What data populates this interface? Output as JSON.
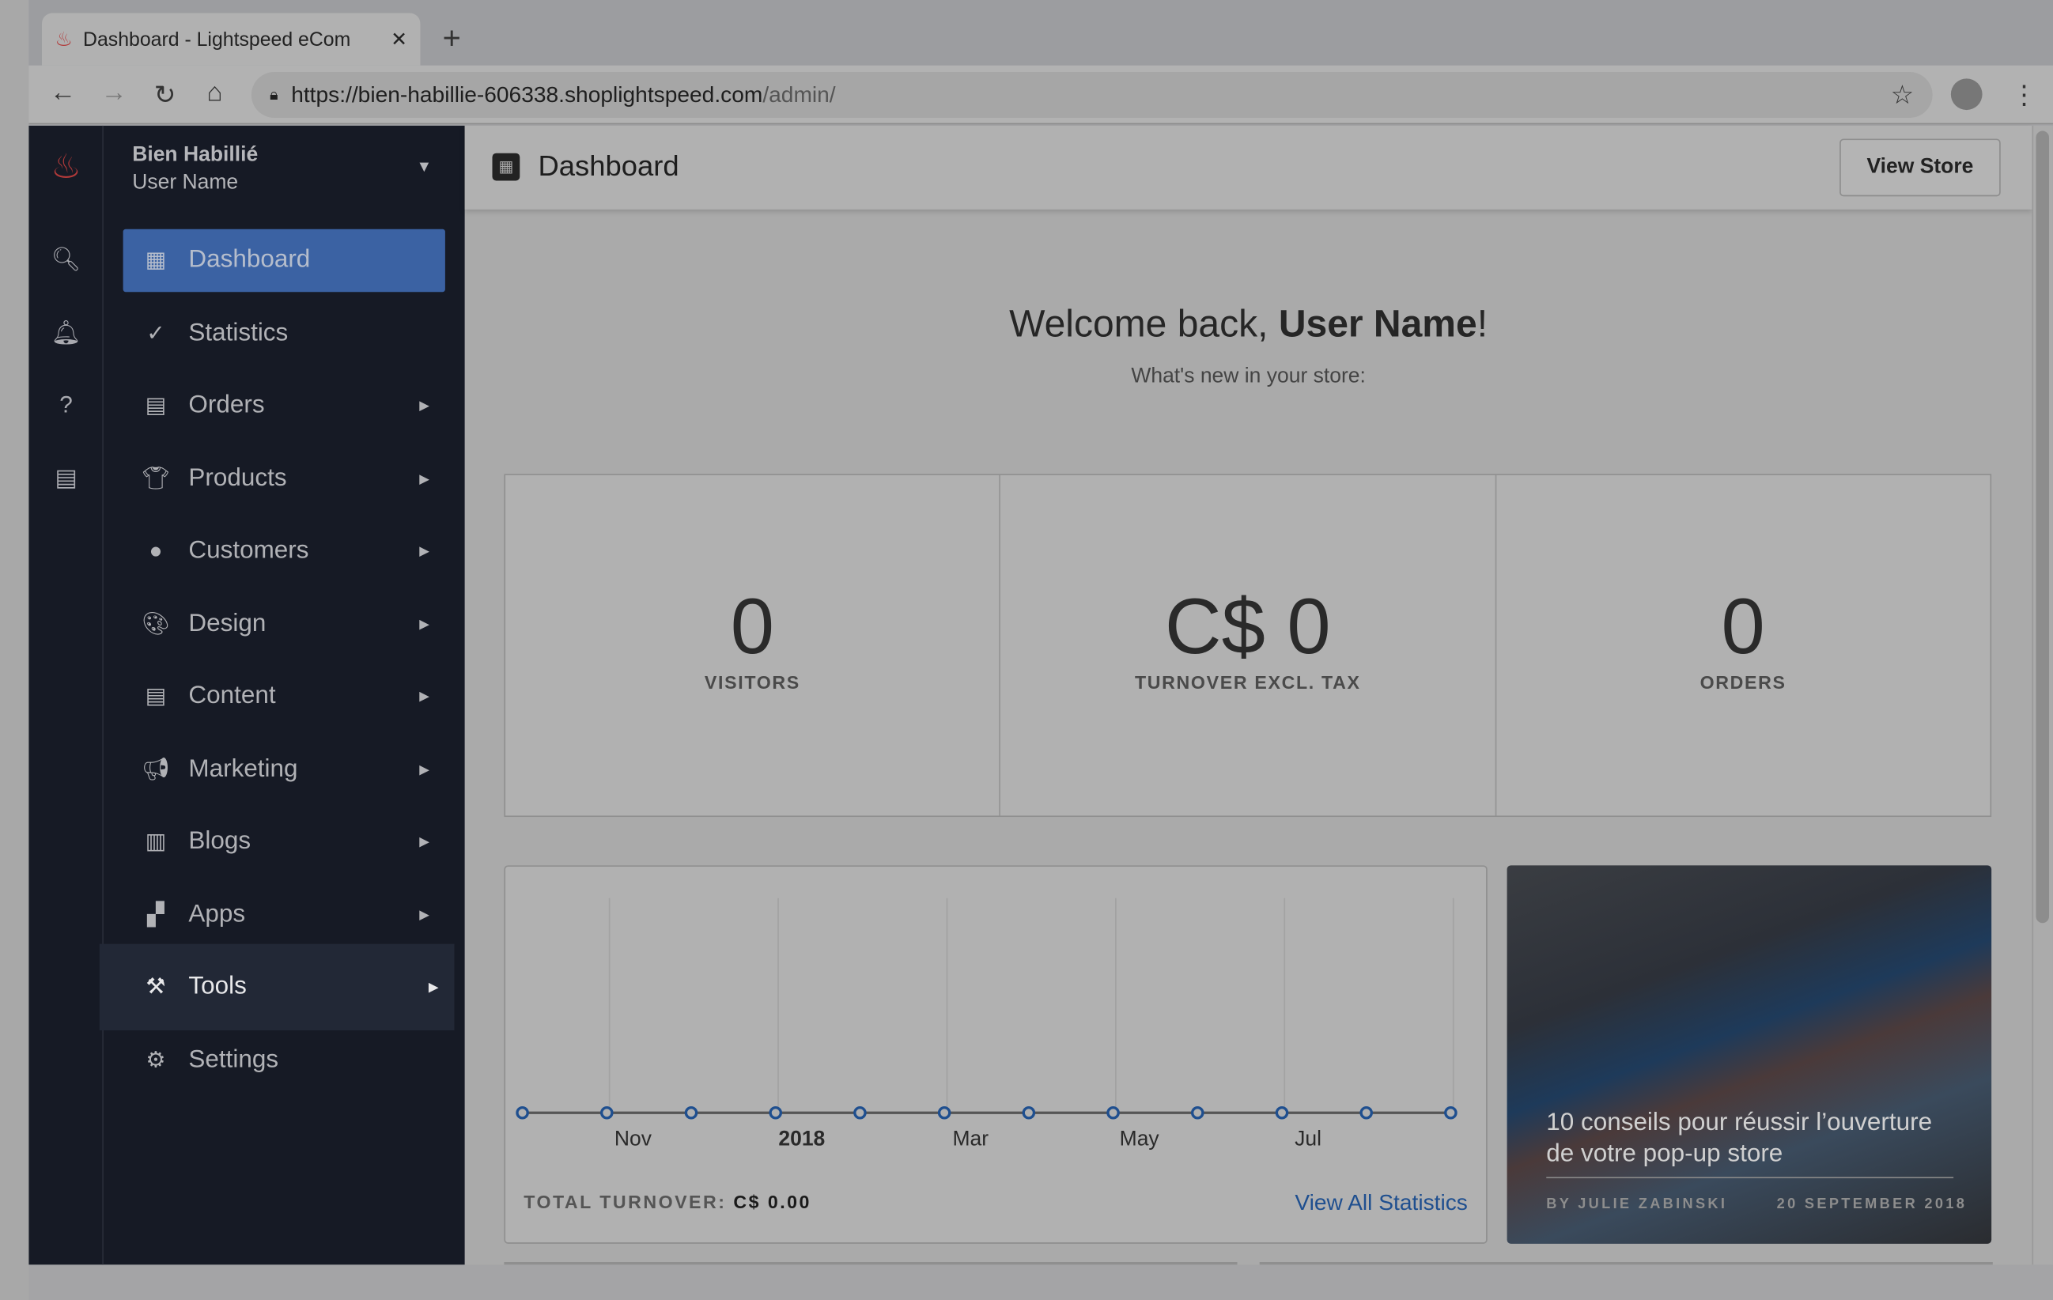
{
  "browser": {
    "tab_title": "Dashboard - Lightspeed eCom",
    "url_host": "https://bien-habillie-606338.shoplightspeed.com",
    "url_path": "/admin/"
  },
  "sidebar": {
    "store_name": "Bien Habillié",
    "user_name": "User Name",
    "items": [
      {
        "label": "Dashboard",
        "icon": "dashboard-icon",
        "state": "active"
      },
      {
        "label": "Statistics",
        "icon": "chart-icon"
      },
      {
        "label": "Orders",
        "icon": "clipboard-icon",
        "submenu": true
      },
      {
        "label": "Products",
        "icon": "shirt-icon",
        "submenu": true
      },
      {
        "label": "Customers",
        "icon": "user-icon",
        "submenu": true
      },
      {
        "label": "Design",
        "icon": "palette-icon",
        "submenu": true
      },
      {
        "label": "Content",
        "icon": "content-icon",
        "submenu": true
      },
      {
        "label": "Marketing",
        "icon": "megaphone-icon",
        "submenu": true
      },
      {
        "label": "Blogs",
        "icon": "blog-icon",
        "submenu": true
      },
      {
        "label": "Apps",
        "icon": "apps-icon",
        "submenu": true
      },
      {
        "label": "Tools",
        "icon": "hammer-icon",
        "submenu": true,
        "state": "hover"
      },
      {
        "label": "Settings",
        "icon": "gear-icon"
      }
    ]
  },
  "header": {
    "title": "Dashboard",
    "view_store": "View Store"
  },
  "welcome": {
    "prefix": "Welcome back, ",
    "name": "User Name",
    "suffix": "!",
    "subtitle": "What's new in your store:"
  },
  "stats": [
    {
      "value": "0",
      "label": "VISITORS"
    },
    {
      "value": "C$ 0",
      "label": "TURNOVER EXCL. TAX"
    },
    {
      "value": "0",
      "label": "ORDERS"
    }
  ],
  "turnover": {
    "label": "TOTAL TURNOVER:",
    "value": "C$ 0.00",
    "link": "View All Statistics"
  },
  "chart_data": {
    "type": "line",
    "tick_labels": [
      "Nov",
      "2018",
      "Mar",
      "May",
      "Jul"
    ],
    "values": [
      0,
      0,
      0,
      0,
      0,
      0,
      0,
      0,
      0,
      0,
      0,
      0
    ],
    "series_color": "#1f4f8f",
    "grid": "vertical"
  },
  "blog": {
    "title": "10 conseils pour réussir l’ouverture de votre pop-up store",
    "author": "BY JULIE ZABINSKI",
    "date": "20 SEPTEMBER 2018"
  },
  "colors": {
    "accent": "#3b62a3",
    "sidebar": "#161a25",
    "brand": "#c0393b"
  }
}
